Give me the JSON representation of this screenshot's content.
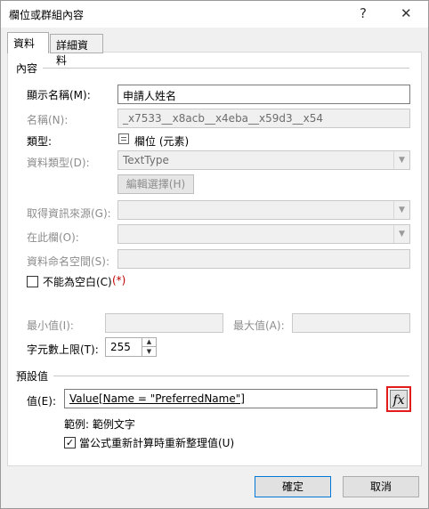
{
  "window": {
    "title": "欄位或群組內容",
    "help_glyph": "?",
    "close_glyph": "✕"
  },
  "tabs": [
    {
      "label": "資料"
    },
    {
      "label": "詳細資料"
    }
  ],
  "content_group": {
    "title": "內容"
  },
  "fields": {
    "display_name_label": "顯示名稱(M):",
    "display_name_value": "申請人姓名",
    "name_label": "名稱(N):",
    "name_value": "_x7533__x8acb__x4eba__x59d3__x54",
    "type_label": "類型:",
    "type_value": "欄位 (元素)",
    "data_type_label": "資料類型(D):",
    "data_type_value": "TextType",
    "edit_choices_button": "編輯選擇(H)",
    "get_info_label": "取得資訊來源(G):",
    "in_field_label": "在此欄(O):",
    "namespace_label": "資料命名空間(S):",
    "cannot_be_blank_label": "不能為空白(C)",
    "cannot_be_blank_checked": false,
    "required_mark": "(*)",
    "min_label": "最小值(I):",
    "max_label": "最大值(A):",
    "max_chars_label": "字元數上限(T):",
    "max_chars_value": "255"
  },
  "default_group": {
    "title": "預設值",
    "value_label": "值(E):",
    "value_text": "Value[Name = \"PreferredName\"]",
    "fx_label": "fx",
    "example_text": "範例: 範例文字",
    "recalc_label": "當公式重新計算時重新整理值(U)",
    "recalc_checked": true
  },
  "footer": {
    "ok_label": "確定",
    "cancel_label": "取消"
  },
  "colors": {
    "highlight_border": "#e21b1b",
    "focus_border": "#0078d7"
  }
}
